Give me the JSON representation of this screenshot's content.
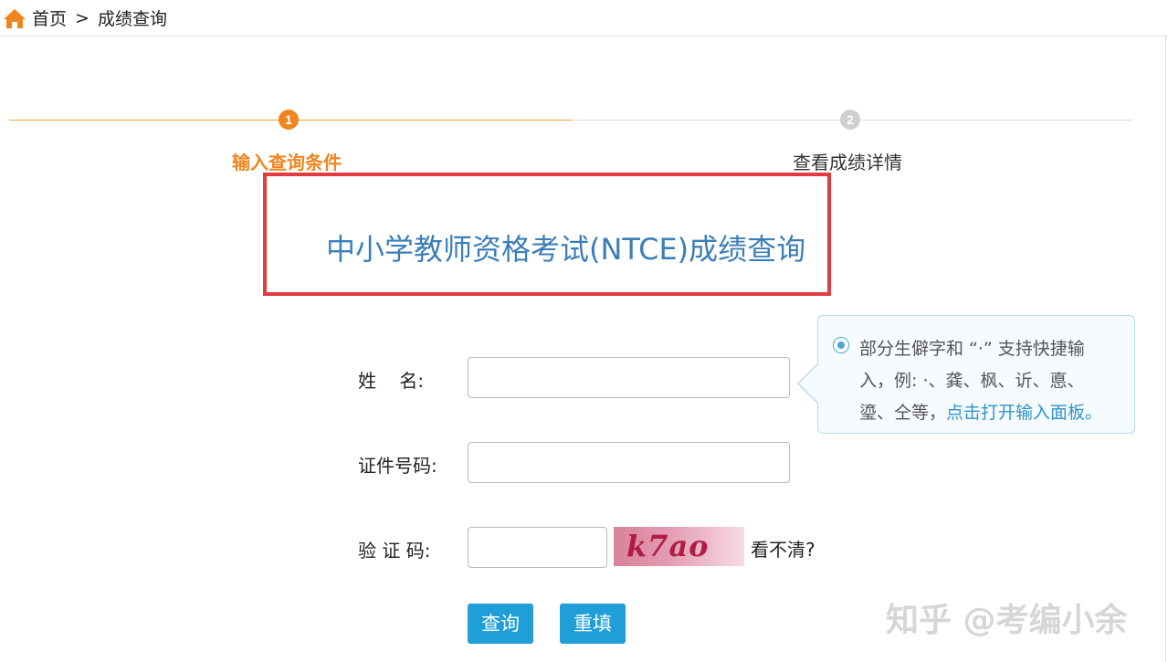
{
  "breadcrumb": {
    "home": "首页",
    "separator": ">",
    "current": "成绩查询"
  },
  "steps": [
    {
      "number": "1",
      "label": "输入查询条件",
      "active": true
    },
    {
      "number": "2",
      "label": "查看成绩详情",
      "active": false
    }
  ],
  "title": "中小学教师资格考试(NTCE)成绩查询",
  "form": {
    "name_label": "姓    名:",
    "name_value": "",
    "id_label": "证件号码:",
    "id_value": "",
    "captcha_label": "验 证 码:",
    "captcha_value": "",
    "captcha_image_text": "k7ao",
    "refresh_label": "看不清?"
  },
  "tooltip": {
    "line1": "部分生僻字和 “·” 支持快捷输",
    "line2": "入，例: ·、龚、枫、䜣、悳、",
    "line3": "瑬、仝等，",
    "link": "点击打开输入面板。"
  },
  "buttons": {
    "query": "查询",
    "reset": "重填"
  },
  "watermark": "知乎 @考编小余",
  "colors": {
    "accent_orange": "#f0851e",
    "title_blue": "#3b7fb8",
    "highlight_red": "#e33b3f",
    "button_blue": "#1f9ed8",
    "link_blue": "#2f94cc"
  }
}
